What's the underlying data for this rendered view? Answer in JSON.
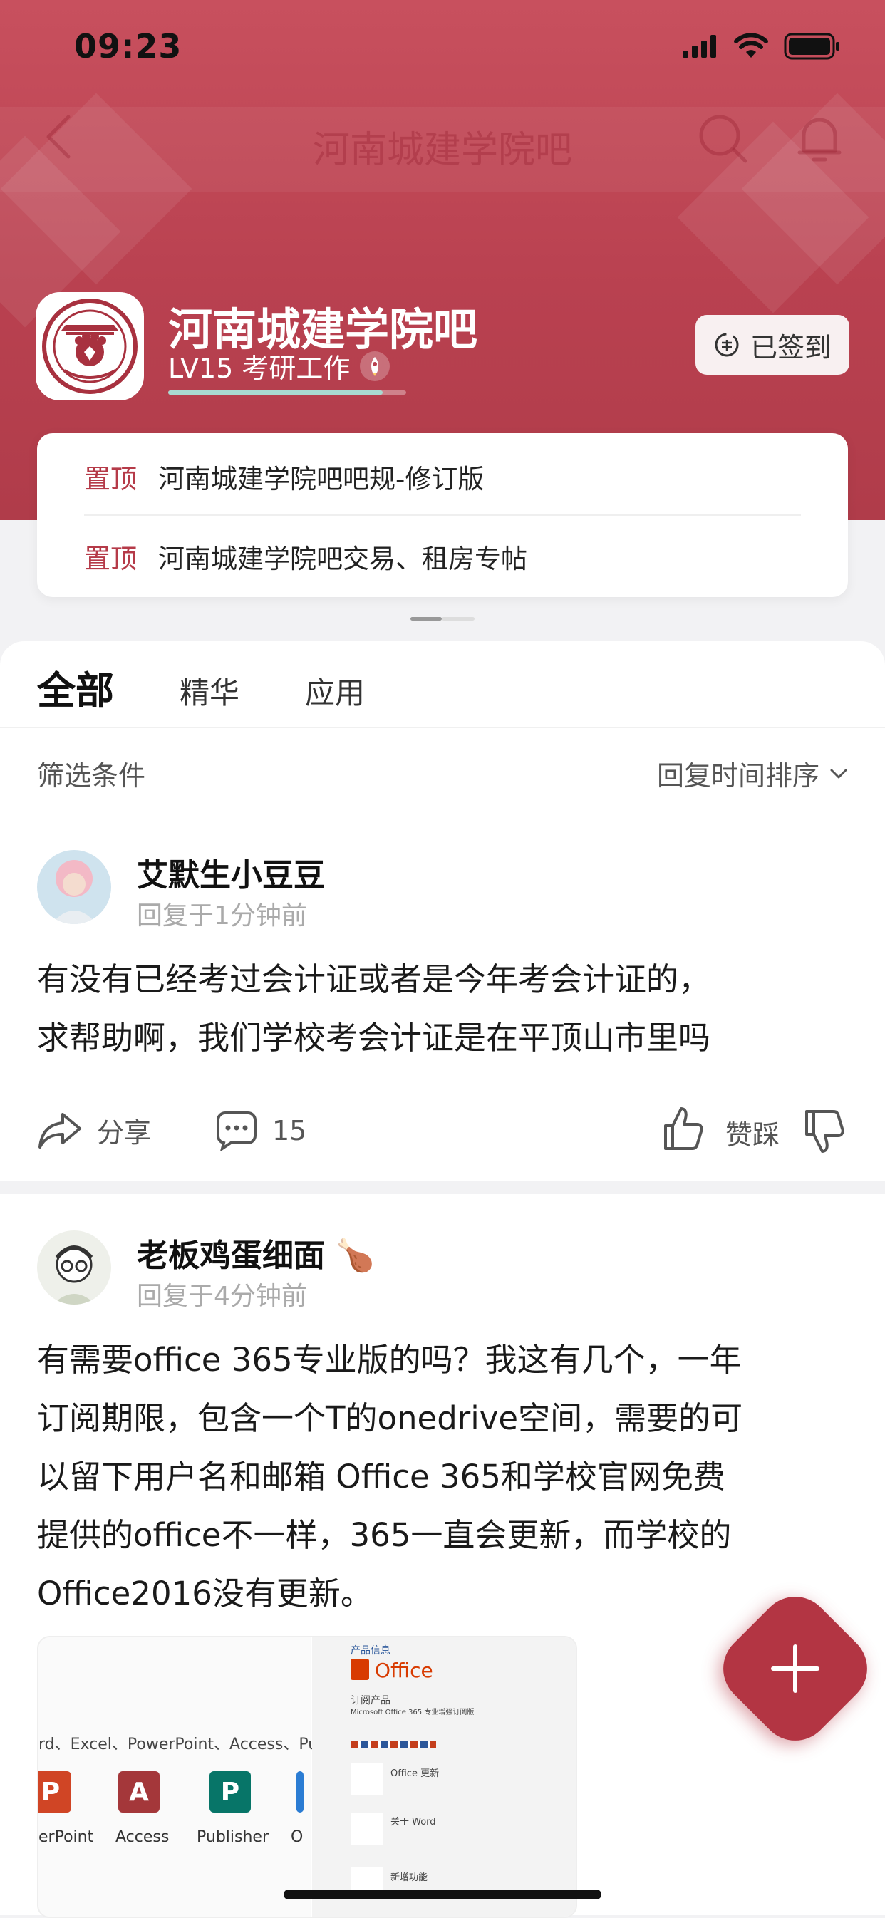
{
  "status_bar": {
    "time": "09:23"
  },
  "nav": {
    "title": "河南城建学院吧"
  },
  "forum": {
    "name": "河南城建学院吧",
    "level": "LV15 考研工作",
    "level_progress": 0.9,
    "signin_label": "已签到"
  },
  "pinned": [
    {
      "tag": "置顶",
      "title": "河南城建学院吧吧规-修订版"
    },
    {
      "tag": "置顶",
      "title": "河南城建学院吧交易、租房专帖"
    }
  ],
  "tabs": [
    "全部",
    "精华",
    "应用"
  ],
  "filter": {
    "label": "筛选条件",
    "sort": "回复时间排序"
  },
  "posts": [
    {
      "author": "艾默生小豆豆",
      "time": "回复于1分钟前",
      "text_line1": "有没有已经考过会计证或者是今年考会计证的，",
      "text_line2": "求帮助啊，我们学校考会计证是在平顶山市里吗",
      "share_label": "分享",
      "comment_count": "15",
      "vote_label": "赞踩"
    },
    {
      "author": "老板鸡蛋细面",
      "author_emoji": "🍗",
      "time": "回复于4分钟前",
      "text_lines": [
        "有需要office 365专业版的吗？我这有几个，一年",
        "订阅期限，包含一个T的onedrive空间，需要的可",
        "以留下用户名和邮箱 Office 365和学校官网免费",
        "提供的office不一样，365一直会更新，而学校的",
        "Office2016没有更新。"
      ]
    }
  ],
  "image_left": {
    "caption": "rd、Excel、PowerPoint、Access、Publisher",
    "apps": [
      "erPoint",
      "Access",
      "Publisher",
      "O"
    ]
  },
  "image_right": {
    "header": "产品信息",
    "office": "Office",
    "subscription": "订阅产品",
    "product": "Microsoft Office 365 专业增强订阅版",
    "update_title": "Office 更新",
    "about_title": "关于 Word",
    "new_title": "新增功能"
  },
  "colors": {
    "brand": "#b33543",
    "header": "#bd4553"
  }
}
